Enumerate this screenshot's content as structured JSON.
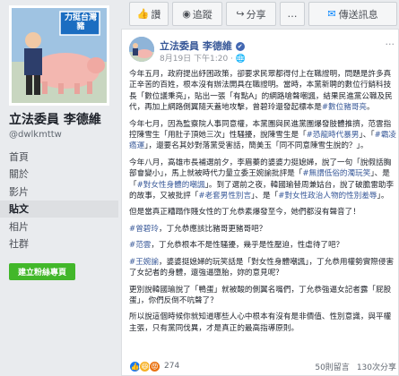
{
  "topbar": {
    "buttons": [
      {
        "label": "讚"
      },
      {
        "label": "追蹤"
      },
      {
        "label": "分享"
      },
      {
        "label": "…"
      },
      {
        "label": "傳送訊息"
      }
    ]
  },
  "profile": {
    "badge_text": "力挺台灣豬",
    "name": "立法委員 李德維",
    "handle": "@dwlkmttw"
  },
  "nav": {
    "items": [
      "首頁",
      "關於",
      "影片",
      "貼文",
      "相片",
      "社群"
    ],
    "active_index": 3,
    "create_page_label": "建立粉絲專頁"
  },
  "post": {
    "author": "立法委員 李德維",
    "verified": "✔",
    "meta": "8月19日 下午1:20 · 🌐",
    "more": "···",
    "paragraphs": [
      {
        "text": "今年五月，政府提出紓困政策，卻要求民眾都得付上在職證明，問題是許多真正辛苦的百姓，根本沒有辦法開具在職證明。當時，本黨新聘的數位行銷科技長「數位議秉亮」，貼出一張「有點A」的網路嗆聲嘲諷，結果民進黨公職及民代，再加上網路側翼隨天蓋地攻擊，曾碧玲還發起標本是",
        "tag": "#數位豬哥亮",
        "after": "。"
      },
      {
        "text": "今年七月，因為監察院人事同意權，本黨團與民進黨團爆發肢體推擠，范雲指控陳雪生「用肚子頂她三次」性騷擾，說陳雪生是「",
        "tag": "#恐龍時代暴男",
        "after": "」、「",
        "tag2": "#霸凌癌運",
        "after2": "」，還要名其妙對落黨受害話，簡美玉「同不同意陳雪生說的？」。"
      },
      {
        "text": "今年八月，高雄市長補選前夕，李眉蓁的婆婆力挺媳婦，說了一句「說假話胸部會變小」，馬上就被時代力量立委王婉諭批評是「",
        "tag": "#無謂低俗的濁玩笑",
        "after": "」、是「",
        "tag2": "#對女性身體的嘲諷",
        "after2": "」。到了選前之夜，韓國瑜替周兼姑台，說了破膽雷助李的故事，又被批評「",
        "tag3": "#老套男性別言",
        "after3": "」、是「",
        "tag4": "#對女性政治人物的性別羞辱",
        "after4": "」。"
      },
      {
        "text": "但是當真正糟蹋作賤女性的丁允恭素爆發至今，她們都沒有聲音了！"
      },
      {
        "text": "",
        "tag": "#曾碧玲",
        "after": "，丁允恭應該比豬哥更豬哥吧？"
      },
      {
        "text": "",
        "tag": "#范雲",
        "after": "，丁允恭根本不是性騷擾，幾乎是性壓迫，性虐待了吧？"
      },
      {
        "text": "",
        "tag": "#王婉諭",
        "after": "，婆婆挺媳婦的玩笑話是「對女性身體嘲諷」，丁允恭用權勢實際侵害了女記者的身體，還強逼墮胎，妳的意見呢？"
      },
      {
        "text": "更別說韓國瑜說了「鴨蛋」就被酸的側翼名嘴們，丁允恭強逼女記者露「屁股蛋」，你們反倒不吭聲了？"
      },
      {
        "text": "所以說這個時候你就知道哪些人心中根本有沒有是非價值、性別意識，與平權主張，只有黨同伐異，才是真正的最高指導原則。"
      }
    ],
    "reactions": {
      "count": "274",
      "comments": "50則留言",
      "shares": "130次分享"
    }
  }
}
